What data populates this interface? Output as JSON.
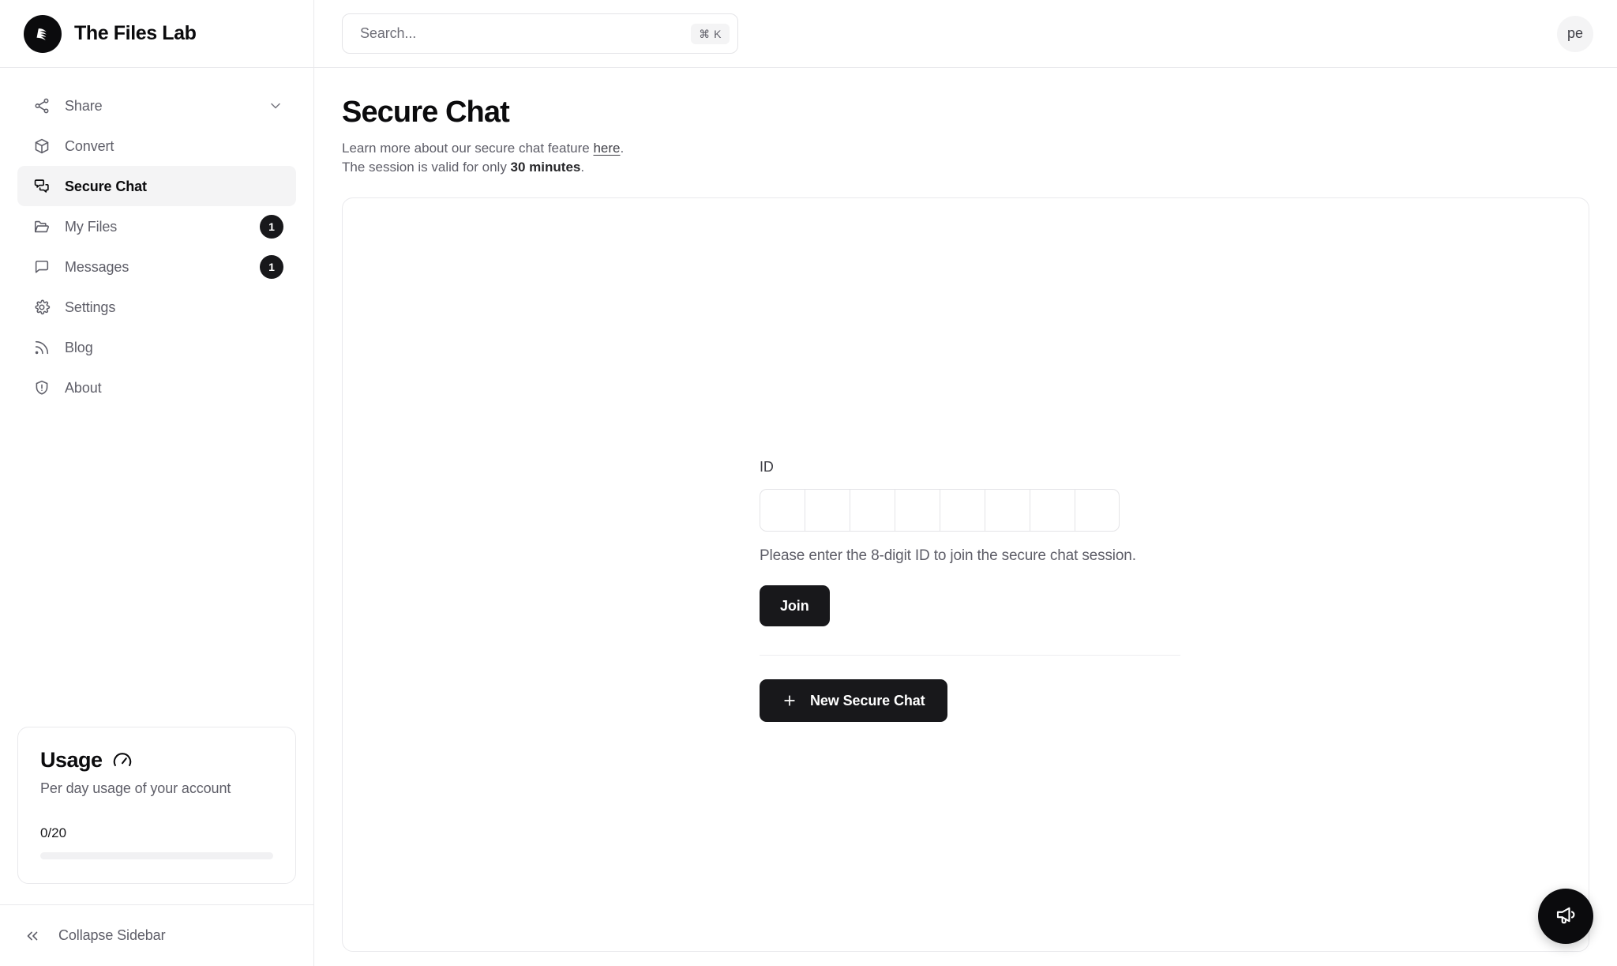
{
  "brand": {
    "name": "The Files Lab",
    "logo_icon": "files-lab-logo-icon"
  },
  "search": {
    "placeholder": "Search...",
    "shortcut": "⌘ K"
  },
  "user": {
    "avatar_initials": "pe"
  },
  "sidebar": {
    "items": [
      {
        "label": "Share",
        "icon": "share-icon",
        "badge": "",
        "trailing": "chevron-down-icon",
        "active": false
      },
      {
        "label": "Convert",
        "icon": "package-icon",
        "badge": "",
        "trailing": "",
        "active": false
      },
      {
        "label": "Secure Chat",
        "icon": "chats-icon",
        "badge": "",
        "trailing": "",
        "active": true
      },
      {
        "label": "My Files",
        "icon": "folder-open-icon",
        "badge": "1",
        "trailing": "",
        "active": false
      },
      {
        "label": "Messages",
        "icon": "message-icon",
        "badge": "1",
        "trailing": "",
        "active": false
      },
      {
        "label": "Settings",
        "icon": "gear-icon",
        "badge": "",
        "trailing": "",
        "active": false
      },
      {
        "label": "Blog",
        "icon": "rss-icon",
        "badge": "",
        "trailing": "",
        "active": false
      },
      {
        "label": "About",
        "icon": "shield-alert-icon",
        "badge": "",
        "trailing": "",
        "active": false
      }
    ],
    "usage": {
      "title": "Usage",
      "gauge_icon": "gauge-icon",
      "subtitle": "Per day usage of your account",
      "count": "0/20",
      "used": 0,
      "limit": 20,
      "progress_percent": 0
    },
    "collapse": {
      "label": "Collapse Sidebar",
      "icon": "chevrons-left-icon"
    }
  },
  "page": {
    "title": "Secure Chat",
    "subtitle_line1_prefix": "Learn more about our secure chat feature ",
    "subtitle_link": "here",
    "subtitle_line1_suffix": ".",
    "subtitle_line2_prefix": "The session is valid for only ",
    "subtitle_line2_strong": "30 minutes",
    "subtitle_line2_suffix": "."
  },
  "join_form": {
    "id_label": "ID",
    "otp_cells": [
      "",
      "",
      "",
      "",
      "",
      "",
      "",
      ""
    ],
    "otp_length": 8,
    "helper_text": "Please enter the 8-digit ID to join the secure chat session.",
    "join_button": "Join",
    "new_chat_button": "New Secure Chat",
    "new_chat_icon": "plus-icon"
  },
  "fab": {
    "icon": "megaphone-icon",
    "label": ""
  },
  "colors": {
    "accent": "#18181b",
    "border": "#e9e9ec",
    "muted_text": "#5e5e68",
    "active_bg": "#f4f4f5",
    "page_bg": "#ffffff"
  }
}
